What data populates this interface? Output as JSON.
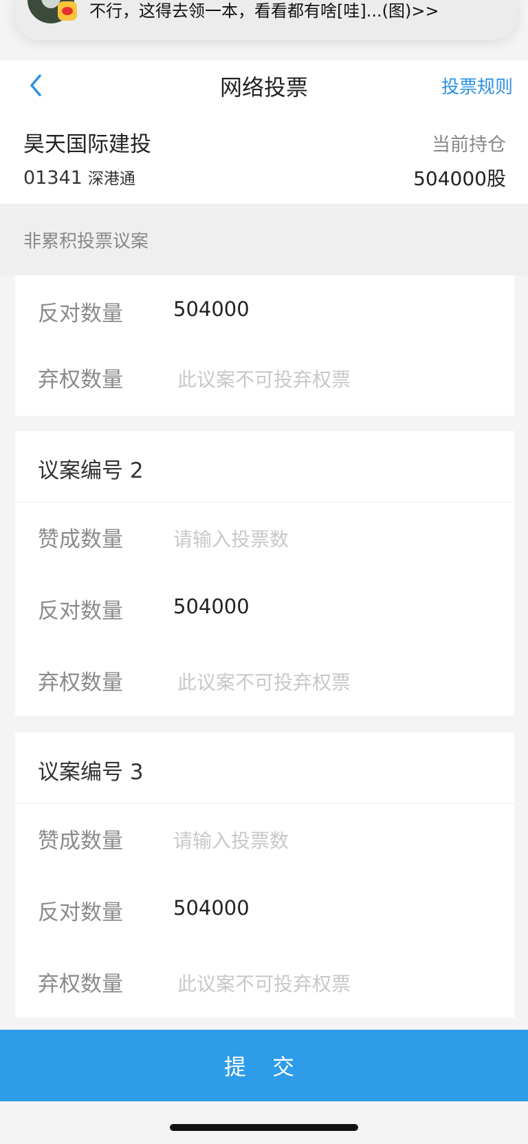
{
  "notification": {
    "text": "不行，这得去领一本，看看都有啥[哇]...(图)>>"
  },
  "header": {
    "title": "网络投票",
    "rules_link": "投票规则"
  },
  "stock": {
    "name": "昊天国际建投",
    "code": "01341",
    "market": "深港通",
    "holding_label": "当前持仓",
    "holding_value": "504000股"
  },
  "section": {
    "label": "非累积投票议案"
  },
  "proposal1_partial": {
    "against": {
      "label": "反对数量",
      "value": "504000"
    },
    "abstain": {
      "label": "弃权数量",
      "note": "此议案不可投弃权票"
    }
  },
  "proposals": [
    {
      "title": "议案编号 2",
      "approve": {
        "label": "赞成数量",
        "placeholder": "请输入投票数"
      },
      "against": {
        "label": "反对数量",
        "value": "504000"
      },
      "abstain": {
        "label": "弃权数量",
        "note": "此议案不可投弃权票"
      }
    },
    {
      "title": "议案编号 3",
      "approve": {
        "label": "赞成数量",
        "placeholder": "请输入投票数"
      },
      "against": {
        "label": "反对数量",
        "value": "504000"
      },
      "abstain": {
        "label": "弃权数量",
        "note": "此议案不可投弃权票"
      }
    }
  ],
  "submit_label": "提 交",
  "colors": {
    "accent": "#2e9ce8",
    "link": "#2b8fe3"
  }
}
